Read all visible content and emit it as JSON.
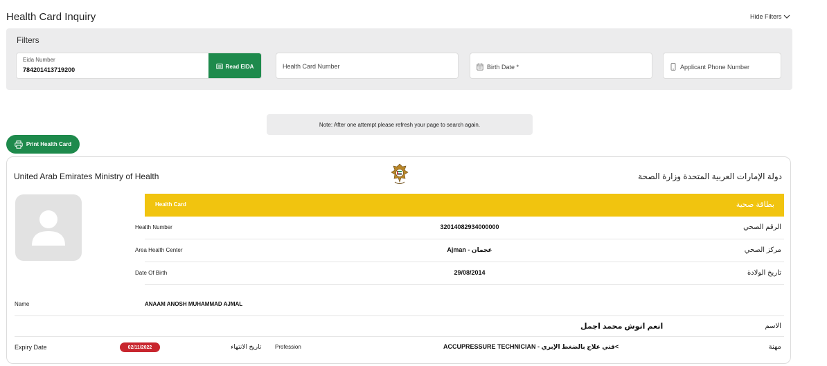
{
  "page": {
    "title": "Health Card Inquiry",
    "hide_filters": "Hide Filters"
  },
  "filters": {
    "title": "Filters",
    "eida_label": "Eida Number",
    "eida_value": "784201413719200",
    "read_eida": "Read EIDA",
    "health_card_number_placeholder": "Health Card Number",
    "birth_date_placeholder": "Birth Date *",
    "phone_placeholder": "Applicant Phone Number"
  },
  "note": "Note: After one attempt please refresh your page to search again.",
  "print_button": "Print Health Card",
  "card": {
    "ministry_en": "United Arab Emirates Ministry of Health",
    "ministry_ar": "دولة الإمارات العربية المتحدة وزارة الصحة",
    "header_en": "Health Card",
    "header_ar": "بطاقة صحية",
    "rows": [
      {
        "label": "Health Number",
        "value": "32014082934000000",
        "label_ar": "الرقم الصحي"
      },
      {
        "label": "Area Health Center",
        "value": "Ajman - عجمان",
        "label_ar": "مركز الصحي"
      },
      {
        "label": "Date Of Birth",
        "value": "29/08/2014",
        "label_ar": "تاريخ الولادة"
      }
    ],
    "name_label": "Name",
    "name_value": "ANAAM ANOSH MUHAMMAD AJMAL",
    "name_ar_value": "انعم انوش محمد اجمل",
    "name_ar_label": "الاسم",
    "expiry_label": "Expiry Date",
    "expiry_value": "02/11/2022",
    "expiry_ar": "تاريخ الانتهاء",
    "profession_label": "Profession",
    "profession_value": "ACCUPRESSURE TECHNICIAN - فني علاج بالضغط الإبري<",
    "profession_ar": "مهنة"
  },
  "colors": {
    "green": "#1e8a4c",
    "yellow": "#f1c40f",
    "red_badge": "#c8262e",
    "panel_gray": "#ececed"
  },
  "icons": [
    "chevron-down-icon",
    "id-card-icon",
    "calendar-icon",
    "phone-icon",
    "printer-icon",
    "uae-emblem-icon",
    "user-placeholder-icon"
  ]
}
